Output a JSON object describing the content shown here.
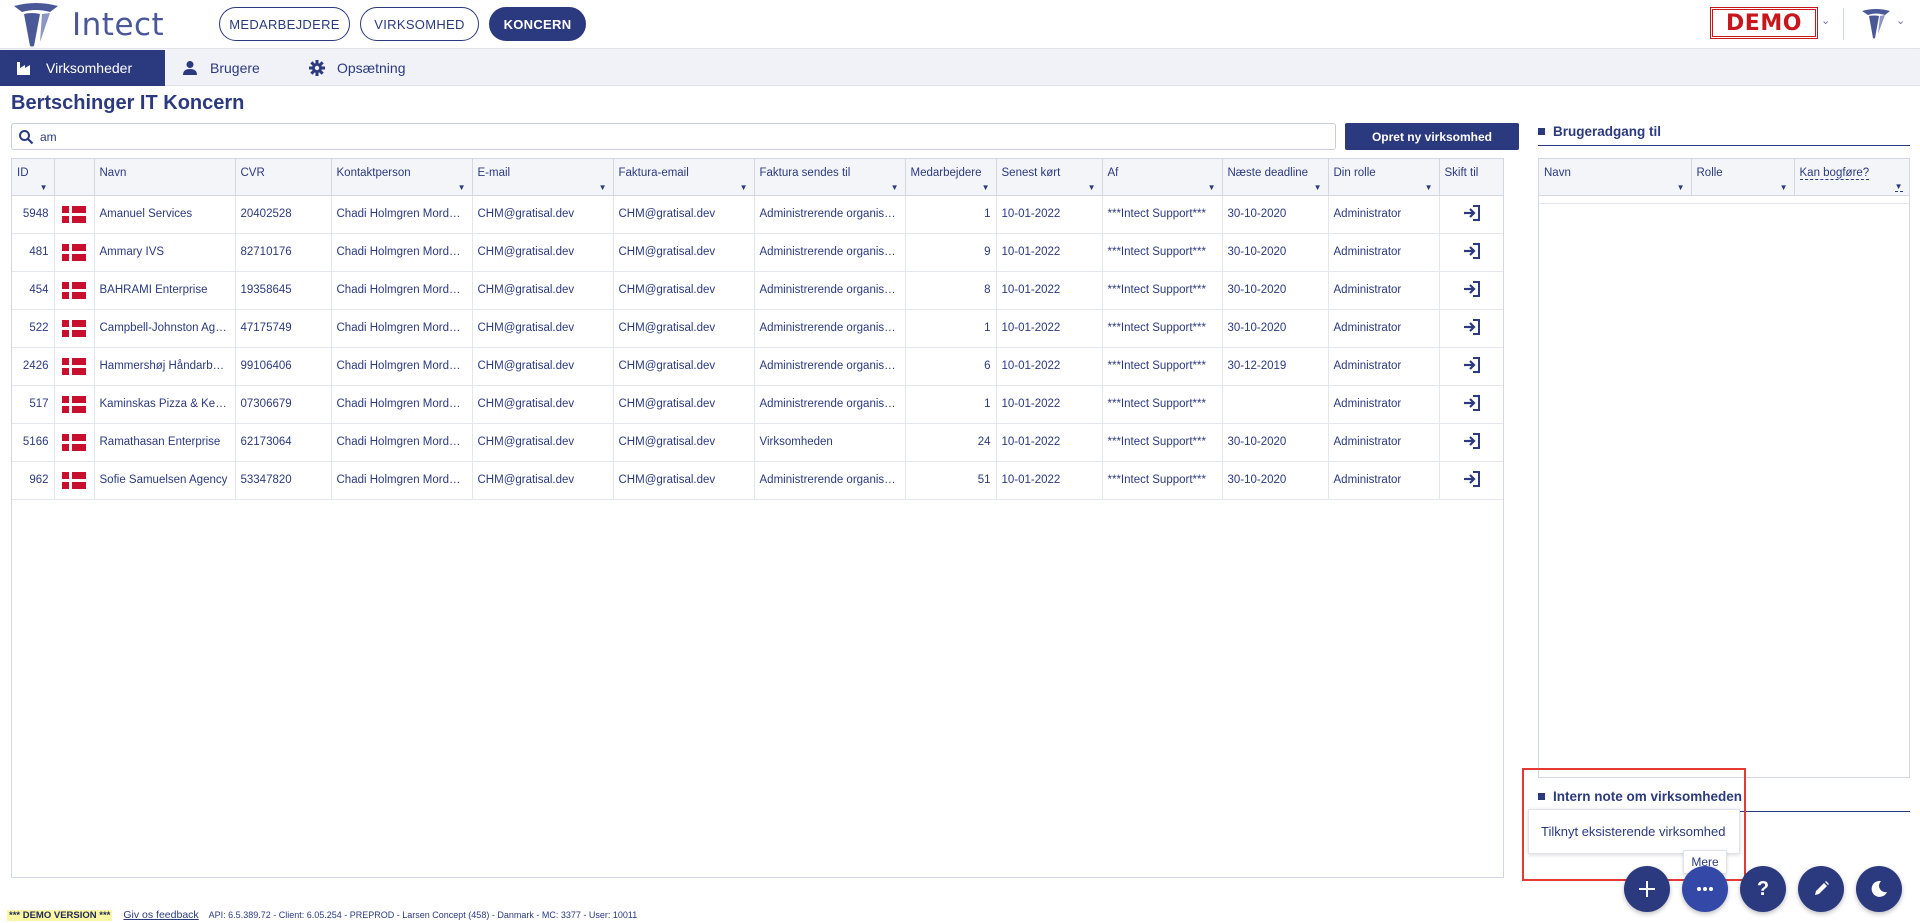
{
  "app": {
    "name": "Intect",
    "demo_badge": "DEMO",
    "top_nav": [
      {
        "label": "MEDARBEJDERE",
        "active": false
      },
      {
        "label": "VIRKSOMHED",
        "active": false
      },
      {
        "label": "KONCERN",
        "active": true
      }
    ]
  },
  "subnav": {
    "tabs": [
      {
        "label": "Virksomheder",
        "icon": "factory-icon",
        "active": true
      },
      {
        "label": "Brugere",
        "icon": "user-icon",
        "active": false
      },
      {
        "label": "Opsætning",
        "icon": "gear-icon",
        "active": false
      }
    ]
  },
  "page": {
    "title": "Bertschinger IT Koncern",
    "search_value": "am",
    "create_button": "Opret ny virksomhed"
  },
  "table": {
    "columns": [
      "ID",
      "",
      "Navn",
      "CVR",
      "Kontaktperson",
      "E-mail",
      "Faktura-email",
      "Faktura sendes til",
      "Medarbejdere",
      "Senest kørt",
      "Af",
      "Næste deadline",
      "Din rolle",
      "Skift til"
    ],
    "rows": [
      {
        "id": "5948",
        "name": "Amanuel Services",
        "cvr": "20402528",
        "contact": "Chadi Holmgren Mordhorst",
        "email": "CHM@gratisal.dev",
        "invoice_email": "CHM@gratisal.dev",
        "invoice_to": "Administrerende organisation",
        "employees": "1",
        "last_run": "10-01-2022",
        "by": "***Intect Support***",
        "deadline": "30-10-2020",
        "role": "Administrator"
      },
      {
        "id": "481",
        "name": "Ammary IVS",
        "cvr": "82710176",
        "contact": "Chadi Holmgren Mordhorst",
        "email": "CHM@gratisal.dev",
        "invoice_email": "CHM@gratisal.dev",
        "invoice_to": "Administrerende organisation",
        "employees": "9",
        "last_run": "10-01-2022",
        "by": "***Intect Support***",
        "deadline": "30-10-2020",
        "role": "Administrator"
      },
      {
        "id": "454",
        "name": "BAHRAMI Enterprise",
        "cvr": "19358645",
        "contact": "Chadi Holmgren Mordhorst",
        "email": "CHM@gratisal.dev",
        "invoice_email": "CHM@gratisal.dev",
        "invoice_to": "Administrerende organisation",
        "employees": "8",
        "last_run": "10-01-2022",
        "by": "***Intect Support***",
        "deadline": "30-10-2020",
        "role": "Administrator"
      },
      {
        "id": "522",
        "name": "Campbell-Johnston Agency",
        "cvr": "47175749",
        "contact": "Chadi Holmgren Mordhorst",
        "email": "CHM@gratisal.dev",
        "invoice_email": "CHM@gratisal.dev",
        "invoice_to": "Administrerende organisation",
        "employees": "1",
        "last_run": "10-01-2022",
        "by": "***Intect Support***",
        "deadline": "30-10-2020",
        "role": "Administrator"
      },
      {
        "id": "2426",
        "name": "Hammershøj Håndarbejde",
        "cvr": "99106406",
        "contact": "Chadi Holmgren Mordhorst",
        "email": "CHM@gratisal.dev",
        "invoice_email": "CHM@gratisal.dev",
        "invoice_to": "Administrerende organisation",
        "employees": "6",
        "last_run": "10-01-2022",
        "by": "***Intect Support***",
        "deadline": "30-12-2019",
        "role": "Administrator"
      },
      {
        "id": "517",
        "name": "Kaminskas Pizza & Kebab",
        "cvr": "07306679",
        "contact": "Chadi Holmgren Mordhorst",
        "email": "CHM@gratisal.dev",
        "invoice_email": "CHM@gratisal.dev",
        "invoice_to": "Administrerende organisation",
        "employees": "1",
        "last_run": "10-01-2022",
        "by": "***Intect Support***",
        "deadline": "",
        "role": "Administrator"
      },
      {
        "id": "5166",
        "name": "Ramathasan Enterprise",
        "cvr": "62173064",
        "contact": "Chadi Holmgren Mordhorst",
        "email": "CHM@gratisal.dev",
        "invoice_email": "CHM@gratisal.dev",
        "invoice_to": "Virksomheden",
        "employees": "24",
        "last_run": "10-01-2022",
        "by": "***Intect Support***",
        "deadline": "30-10-2020",
        "role": "Administrator"
      },
      {
        "id": "962",
        "name": "Sofie Samuelsen Agency",
        "cvr": "53347820",
        "contact": "Chadi Holmgren Mordhorst",
        "email": "CHM@gratisal.dev",
        "invoice_email": "CHM@gratisal.dev",
        "invoice_to": "Administrerende organisation",
        "employees": "51",
        "last_run": "10-01-2022",
        "by": "***Intect Support***",
        "deadline": "30-10-2020",
        "role": "Administrator"
      }
    ]
  },
  "right_panel": {
    "title": "Brugeradgang til",
    "columns": [
      "Navn",
      "Rolle",
      "Kan bogføre?"
    ],
    "note_title": "Intern note om virksomheden"
  },
  "popup": {
    "menu_item": "Tilknyt eksisterende virksomhed",
    "tooltip": "Mere"
  },
  "footer": {
    "demo": "*** DEMO VERSION ***",
    "feedback": "Giv os feedback",
    "info": "API: 6.5.389.72 - Client: 6.05.254 - PREPROD  - Larsen Concept (458) - Danmark - MC: 3377  - User: 10011"
  },
  "colors": {
    "primary": "#2b3a7e",
    "demo_red": "#c8161d",
    "highlight_red": "#e53935"
  }
}
